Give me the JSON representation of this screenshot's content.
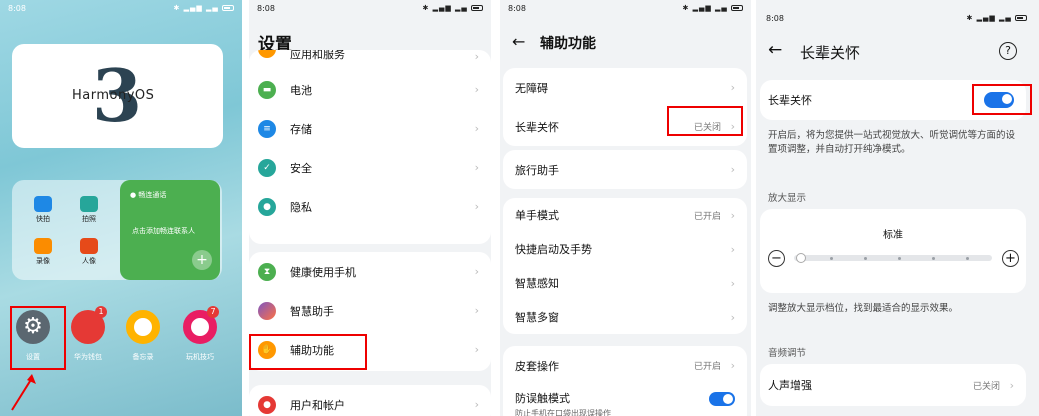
{
  "status": {
    "time": "8:08"
  },
  "home": {
    "brand": "HarmonyOS",
    "brand_number": "3",
    "widget_title": "畅连通话",
    "widget_body": "点击添加畅连联系人",
    "widget_plus": "+",
    "mini_apps": [
      {
        "label": "快拍",
        "color": "#1e88e5"
      },
      {
        "label": "拍照",
        "color": "#26a69a"
      },
      {
        "label": "录像",
        "color": "#fb8c00"
      },
      {
        "label": "人像",
        "color": "#e64a19"
      }
    ],
    "dock": [
      {
        "label": "设置",
        "icon": "gear-icon",
        "color": "#5b6770",
        "badge": ""
      },
      {
        "label": "华为钱包",
        "icon": "wallet-icon",
        "color": "#e53935",
        "badge": "1"
      },
      {
        "label": "备忘录",
        "icon": "memo-icon",
        "color": "#ffb300",
        "badge": ""
      },
      {
        "label": "玩机技巧",
        "icon": "tips-icon",
        "color": "#e91e63",
        "badge": "7"
      }
    ]
  },
  "settings": {
    "title": "设置",
    "items_group1": [
      {
        "label": "应用和服务",
        "color": "#ff9800",
        "icon": "apps-icon"
      },
      {
        "label": "电池",
        "color": "#4caf50",
        "icon": "battery-icon"
      },
      {
        "label": "存储",
        "color": "#1e88e5",
        "icon": "storage-icon"
      },
      {
        "label": "安全",
        "color": "#26a69a",
        "icon": "shield-icon"
      },
      {
        "label": "隐私",
        "color": "#26a69a",
        "icon": "privacy-icon"
      }
    ],
    "items_group2": [
      {
        "label": "健康使用手机",
        "color": "#4caf50",
        "icon": "hourglass-icon"
      },
      {
        "label": "智慧助手",
        "color": "#9c27b0",
        "icon": "assistant-icon"
      },
      {
        "label": "辅助功能",
        "color": "#ff9800",
        "icon": "hand-icon"
      }
    ],
    "items_group3": [
      {
        "label": "用户和帐户",
        "color": "#e53935",
        "icon": "user-icon"
      }
    ]
  },
  "accessibility": {
    "title": "辅助功能",
    "groups": [
      [
        {
          "label": "无障碍",
          "value": ""
        },
        {
          "label": "长辈关怀",
          "value": "已关闭"
        }
      ],
      [
        {
          "label": "旅行助手",
          "value": ""
        }
      ],
      [
        {
          "label": "单手模式",
          "value": "已开启"
        },
        {
          "label": "快捷启动及手势",
          "value": ""
        },
        {
          "label": "智慧感知",
          "value": ""
        },
        {
          "label": "智慧多窗",
          "value": ""
        }
      ],
      [
        {
          "label": "皮套操作",
          "value": "已开启"
        },
        {
          "label": "防误触模式",
          "sub": "防止手机在口袋出现误操作",
          "value": ""
        }
      ]
    ]
  },
  "elder": {
    "title": "长辈关怀",
    "toggle_label": "长辈关怀",
    "description": "开启后，将为您提供一站式视觉放大、听觉调优等方面的设置项调整，并自动打开纯净模式。",
    "section_display": "放大显示",
    "level": "标准",
    "minus": "−",
    "plus": "+",
    "display_hint": "调整放大显示档位，找到最适合的显示效果。",
    "section_audio": "音频调节",
    "voice_label": "人声增强",
    "voice_value": "已关闭"
  },
  "colors": {
    "accent": "#1a73e8",
    "highlight": "#e00000"
  }
}
